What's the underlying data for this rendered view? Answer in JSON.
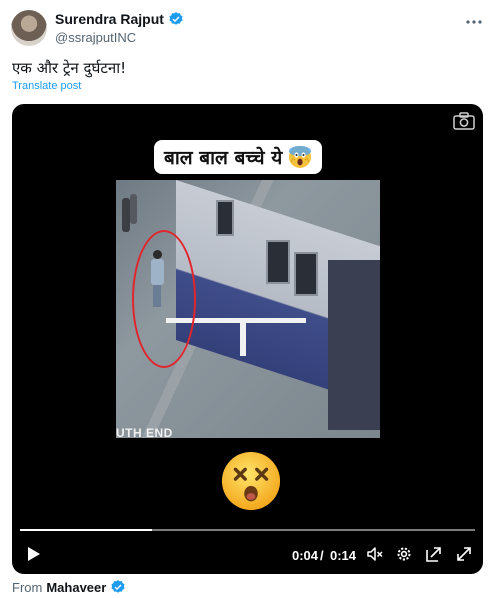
{
  "author": {
    "display_name": "Surendra Rajput",
    "handle": "@ssrajputINC"
  },
  "post": {
    "text": "एक और ट्रेन दुर्घटना!",
    "translate_label": "Translate post"
  },
  "video": {
    "caption": "बाल बाल बच्चे ये",
    "sign_text": "UTH END",
    "current_time": "0:04",
    "separator": "/",
    "duration": "0:14",
    "progress_fraction": 0.29
  },
  "attribution": {
    "from_label": "From",
    "from_name": "Mahaveer"
  },
  "icons": {
    "verified": "verified-badge-icon",
    "more": "more-icon",
    "camera": "camera-icon",
    "play": "play-icon",
    "mute": "volume-muted-icon",
    "settings": "gear-icon",
    "exit_pip": "picture-in-picture-icon",
    "fullscreen": "fullscreen-icon"
  },
  "colors": {
    "accent": "#1d9bf0",
    "circle": "#e0262c"
  }
}
